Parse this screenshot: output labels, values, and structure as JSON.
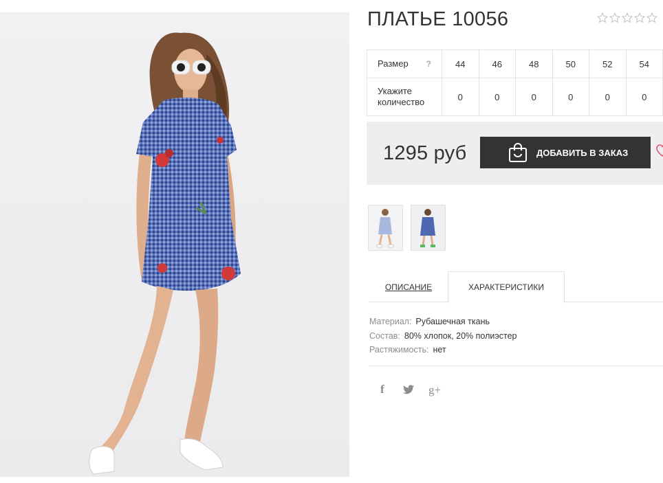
{
  "product": {
    "title": "ПЛАТЬЕ 10056",
    "rating_stars": 0,
    "rating_max": 5
  },
  "sizes": {
    "size_label": "Размер",
    "help_glyph": "?",
    "quantity_label": "Укажите количество",
    "columns": [
      "44",
      "46",
      "48",
      "50",
      "52",
      "54"
    ],
    "quantities": [
      "0",
      "0",
      "0",
      "0",
      "0",
      "0"
    ]
  },
  "purchase": {
    "price": "1295 руб",
    "add_button_label": "ДОБАВИТЬ В ЗАКАЗ"
  },
  "tabs": {
    "description": "ОПИСАНИЕ",
    "specs": "ХАРАКТЕРИСТИКИ",
    "active": "specs"
  },
  "specs": [
    {
      "key": "Материал:",
      "value": "Рубашечная ткань"
    },
    {
      "key": "Состав:",
      "value": "80% хлопок, 20% полиэстер"
    },
    {
      "key": "Растяжимость:",
      "value": "нет"
    }
  ],
  "social": {
    "facebook_glyph": "f",
    "google_glyph": "g+"
  },
  "colors": {
    "button_bg": "#333333",
    "price_box_bg": "#eeeeee",
    "heart": "#e0566e",
    "dress_blue": "#5872b8",
    "flower_red": "#d23a3a"
  },
  "icons": [
    "star-icon",
    "question-icon",
    "shopping-bag-icon",
    "heart-icon",
    "facebook-icon",
    "twitter-icon",
    "google-plus-icon"
  ]
}
